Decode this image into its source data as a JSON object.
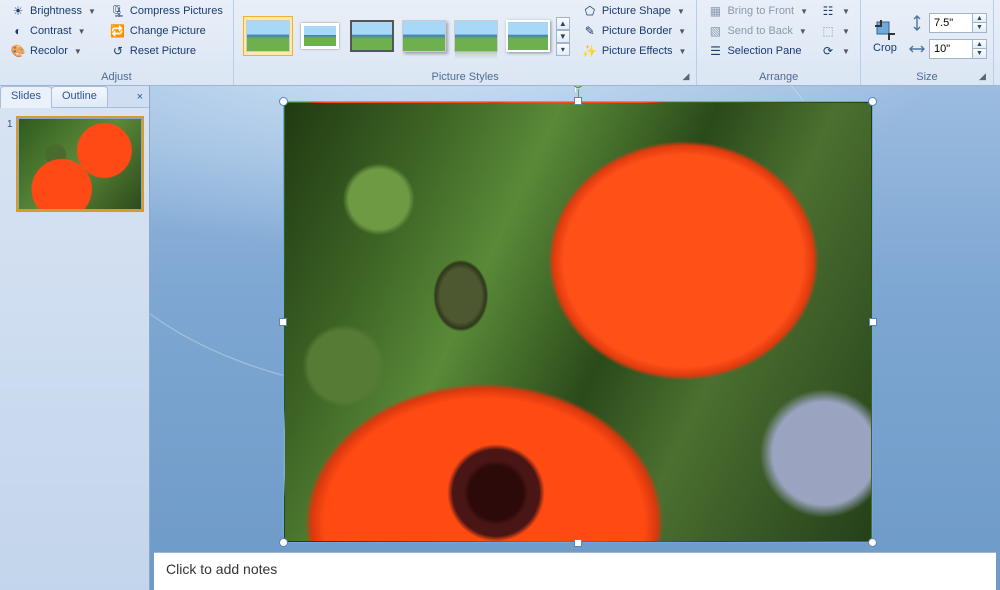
{
  "ribbon": {
    "adjust": {
      "label": "Adjust",
      "brightness": "Brightness",
      "contrast": "Contrast",
      "recolor": "Recolor",
      "compress": "Compress Pictures",
      "change": "Change Picture",
      "reset": "Reset Picture"
    },
    "styles": {
      "label": "Picture Styles",
      "shape": "Picture Shape",
      "border": "Picture Border",
      "effects": "Picture Effects"
    },
    "arrange": {
      "label": "Arrange",
      "front": "Bring to Front",
      "back": "Send to Back",
      "pane": "Selection Pane"
    },
    "size": {
      "label": "Size",
      "crop": "Crop",
      "height": "7.5\"",
      "width": "10\""
    }
  },
  "sidepane": {
    "tab_slides": "Slides",
    "tab_outline": "Outline",
    "slide_number": "1"
  },
  "notes": {
    "placeholder": "Click to add notes"
  }
}
